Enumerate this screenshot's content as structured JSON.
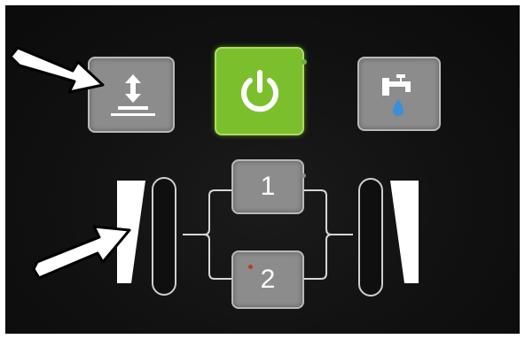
{
  "panel": {
    "buttons": {
      "lift": {
        "icon": "lift-updown-icon"
      },
      "power": {
        "icon": "power-icon"
      },
      "water": {
        "icon": "faucet-water-icon"
      },
      "preset1": {
        "label": "1"
      },
      "preset2": {
        "label": "2"
      }
    },
    "left_scale": {
      "plus": "+",
      "minus": "–"
    },
    "right_scale": {
      "plus": "+",
      "minus": "–"
    }
  },
  "colors": {
    "panel_bg": "#111111",
    "button_grey": "#8c8c8c",
    "power_green": "#7cbf2c",
    "led_green": "#69b33a",
    "led_red": "#c0392b",
    "water_drop": "#3a8fd8",
    "arrow": "#ffffff"
  }
}
